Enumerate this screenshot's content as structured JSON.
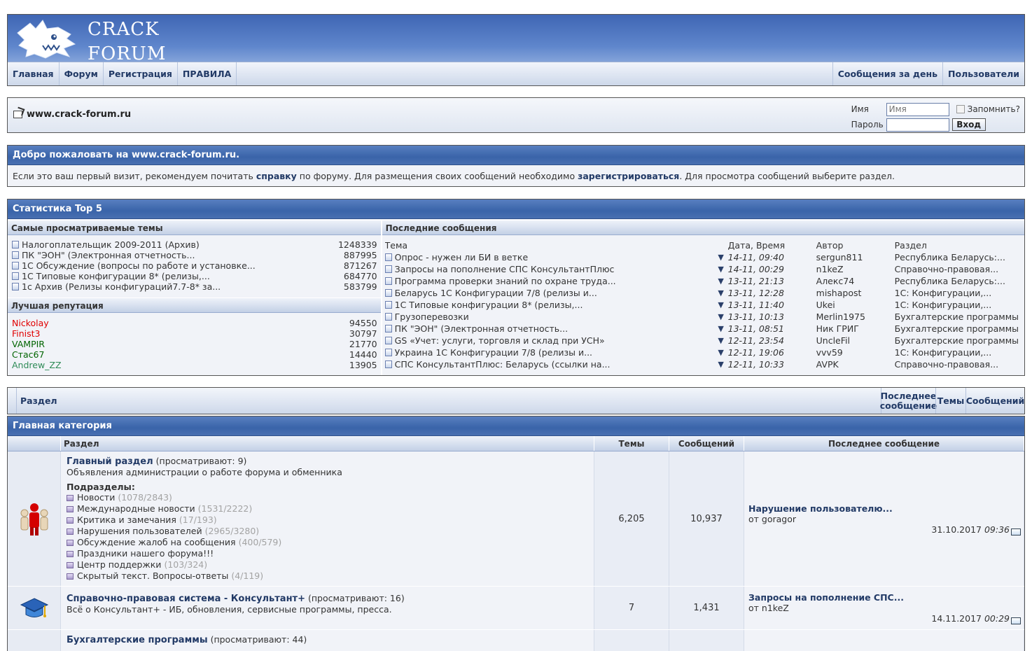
{
  "header": {
    "logo_line1": "CRACK",
    "logo_line2": "FORUM",
    "nav_left": [
      "Главная",
      "Форум",
      "Регистрация",
      "ПРАВИЛА"
    ],
    "nav_right": [
      "Сообщения за день",
      "Пользователи"
    ]
  },
  "loginbar": {
    "site": "www.crack-forum.ru",
    "name_label": "Имя",
    "name_placeholder": "Имя",
    "remember_label": "Запомнить?",
    "password_label": "Пароль",
    "login_button": "Вход"
  },
  "welcome": {
    "title": "Добро пожаловать на www.crack-forum.ru.",
    "text_1": "Если это ваш первый визит, рекомендуем почитать ",
    "link_help": "справку",
    "text_2": " по форуму. Для размещения своих сообщений необходимо ",
    "link_register": "зарегистрироваться",
    "text_3": ". Для просмотра сообщений выберите раздел."
  },
  "stats": {
    "title": "Статистика Top 5",
    "most_viewed_title": "Самые просматриваемые темы",
    "most_viewed": [
      {
        "title": "Налогоплательщик 2009-2011 (Архив)",
        "count": "1248339"
      },
      {
        "title": "ПК \"ЭОН\" (Электронная отчетность...",
        "count": "887995"
      },
      {
        "title": "1С Обсуждение (вопросы по работе и установке...",
        "count": "871267"
      },
      {
        "title": "1С Типовые конфигурации 8* (релизы,...",
        "count": "684770"
      },
      {
        "title": "1с Архив (Релизы конфигураций7.7-8* за...",
        "count": "583799"
      }
    ],
    "reputation_title": "Лучшая репутация",
    "reputation": [
      {
        "name": "Nickolay",
        "value": "94550",
        "color": "#e00000"
      },
      {
        "name": "Finist3",
        "value": "30797",
        "color": "#e00000"
      },
      {
        "name": "VAMPIR",
        "value": "21770",
        "color": "#006400"
      },
      {
        "name": "Стас67",
        "value": "14440",
        "color": "#006400"
      },
      {
        "name": "Andrew_ZZ",
        "value": "13905",
        "color": "#2e8b57"
      }
    ],
    "last_posts_title": "Последние сообщения",
    "last_posts_headers": {
      "topic": "Тема",
      "date": "Дата, Время",
      "author": "Автор",
      "section": "Раздел"
    },
    "last_posts": [
      {
        "topic": "Опрос - нужен ли БИ в ветке",
        "date": "14-11, 09:40",
        "author": "sergun811",
        "section": "Республика Беларусь:..."
      },
      {
        "topic": "Запросы на пополнение СПС КонсультантПлюс",
        "date": "14-11, 00:29",
        "author": "n1keZ",
        "section": "Справочно-правовая..."
      },
      {
        "topic": "Программа проверки знаний по охране труда...",
        "date": "13-11, 21:13",
        "author": "Алекс74",
        "section": "Республика Беларусь:..."
      },
      {
        "topic": "Беларусь 1С Конфигурации 7/8 (релизы и...",
        "date": "13-11, 12:28",
        "author": "mishapost",
        "section": "1С: Конфигурации,..."
      },
      {
        "topic": "1С Типовые конфигурации 8* (релизы,...",
        "date": "13-11, 11:40",
        "author": "Ukei",
        "section": "1С: Конфигурации,..."
      },
      {
        "topic": "Грузоперевозки",
        "date": "13-11, 10:13",
        "author": "Merlin1975",
        "section": "Бухгалтерские программы"
      },
      {
        "topic": "ПК \"ЭОН\" (Электронная отчетность...",
        "date": "13-11, 08:51",
        "author": "Ник ГРИГ",
        "section": "Бухгалтерские программы"
      },
      {
        "topic": "GS «Учет: услуги, торговля и склад при УСН»",
        "date": "12-11, 23:54",
        "author": "UncleFil",
        "section": "Бухгалтерские программы"
      },
      {
        "topic": "Украина 1С Конфигурации 7/8 (релизы и...",
        "date": "12-11, 19:06",
        "author": "vvv59",
        "section": "1С: Конфигурации,..."
      },
      {
        "topic": "СПС КонсультантПлюс: Беларусь (ссылки на...",
        "date": "12-11, 10:33",
        "author": "AVPK",
        "section": "Справочно-правовая..."
      }
    ]
  },
  "forum_header": {
    "section": "Раздел",
    "last_post": "Последнее сообщение",
    "topics": "Темы",
    "posts": "Сообщений"
  },
  "main_category": {
    "title": "Главная категория",
    "col_section": "Раздел",
    "col_topics": "Темы",
    "col_posts": "Сообщений",
    "col_last": "Последнее сообщение",
    "forums": [
      {
        "title": "Главный раздел",
        "viewers": "(просматривают: 9)",
        "desc": "Объявления администрации о работе форума и обменника",
        "subforums_label": "Подразделы",
        "subforums": [
          {
            "name": "Новости",
            "count": "(1078/2843)"
          },
          {
            "name": "Международные новости",
            "count": "(1531/2222)"
          },
          {
            "name": "Критика и замечания",
            "count": "(17/193)"
          },
          {
            "name": "Нарушения пользователей",
            "count": "(2965/3280)"
          },
          {
            "name": "Обсуждение жалоб на сообщения",
            "count": "(400/579)"
          },
          {
            "name": "Праздники нашего форума!!!",
            "count": ""
          },
          {
            "name": "Центр поддержки",
            "count": "(103/324)"
          },
          {
            "name": "Скрытый текст. Вопросы-ответы",
            "count": "(4/119)"
          }
        ],
        "topics": "6,205",
        "posts": "10,937",
        "last_title": "Нарушение пользователю...",
        "last_by": "от goragor",
        "last_date": "31.10.2017",
        "last_time": "09:36"
      },
      {
        "title": "Справочно-правовая система - Консультант+",
        "viewers": "(просматривают: 16)",
        "desc": "Всё о Консультант+ - ИБ, обновления, сервисные программы, пресса.",
        "topics": "7",
        "posts": "1,431",
        "last_title": "Запросы на пополнение СПС...",
        "last_by": "от n1keZ",
        "last_date": "14.11.2017",
        "last_time": "00:29"
      },
      {
        "title": "Бухгалтерские программы",
        "viewers": "(просматривают: 44)",
        "desc": ""
      }
    ]
  }
}
